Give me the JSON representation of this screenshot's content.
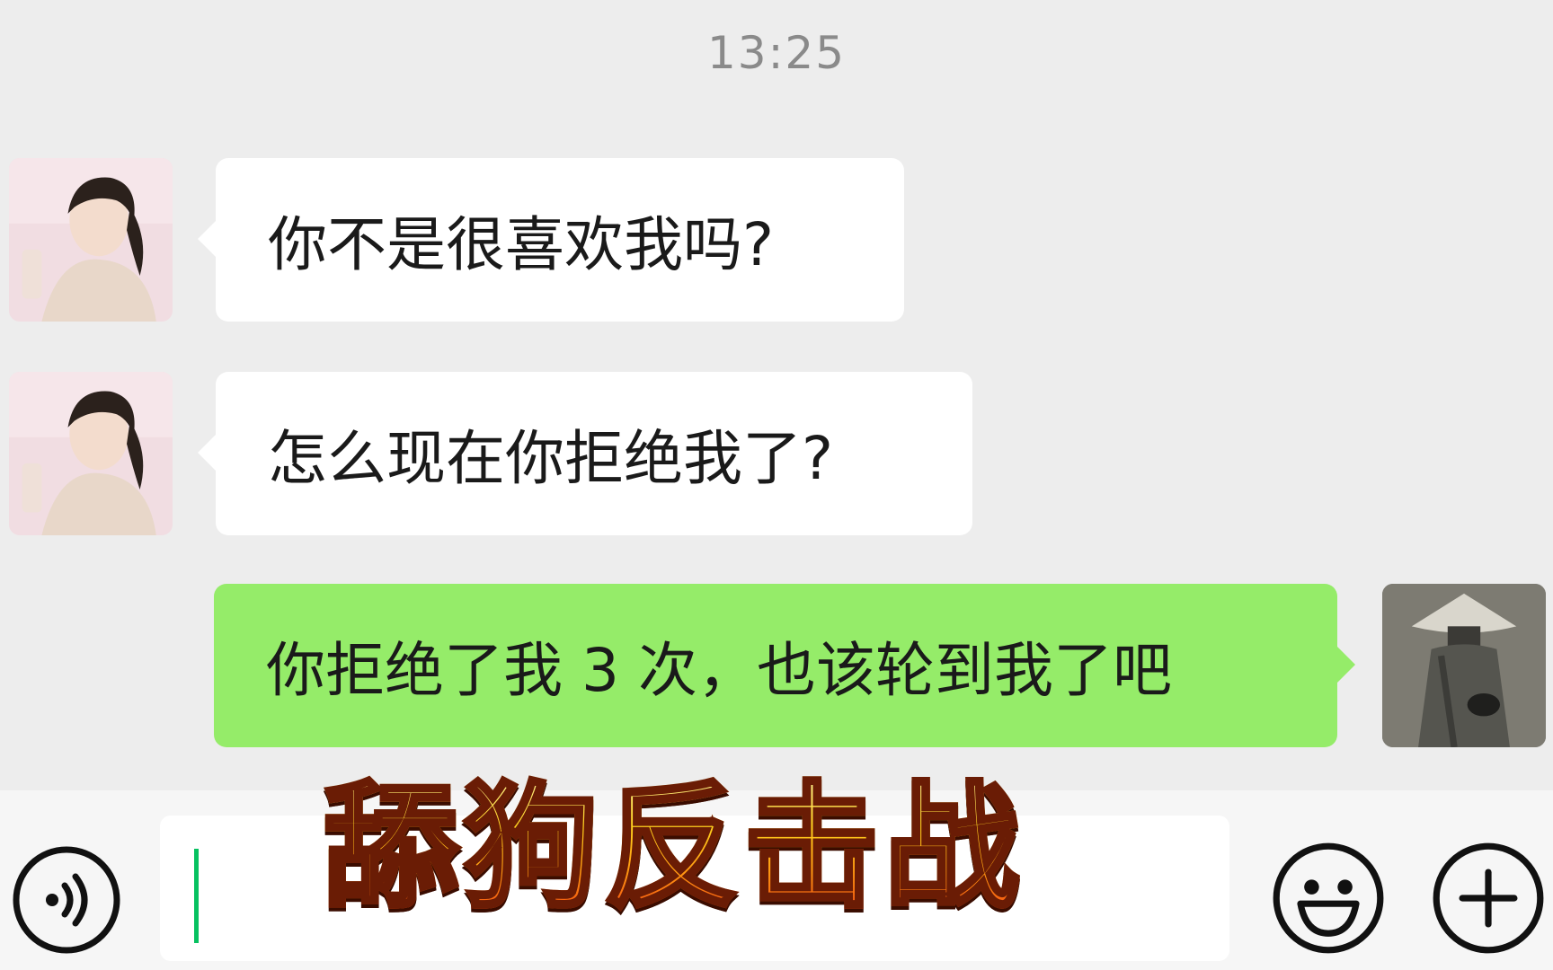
{
  "chat": {
    "timestamp": "13:25",
    "messages": [
      {
        "sender": "contact",
        "text": "你不是很喜欢我吗?"
      },
      {
        "sender": "contact",
        "text": "怎么现在你拒绝我了?"
      },
      {
        "sender": "me",
        "text": "你拒绝了我 3 次，也该轮到我了吧"
      }
    ]
  },
  "input_bar": {
    "value": "",
    "voice_icon": "voice-icon",
    "emoji_icon": "emoji-icon",
    "add_icon": "add-icon"
  },
  "overlay": {
    "title": "舔狗反击战"
  },
  "colors": {
    "background": "#ededed",
    "incoming_bubble": "#ffffff",
    "outgoing_bubble": "#95ec69",
    "caret": "#07c160"
  }
}
